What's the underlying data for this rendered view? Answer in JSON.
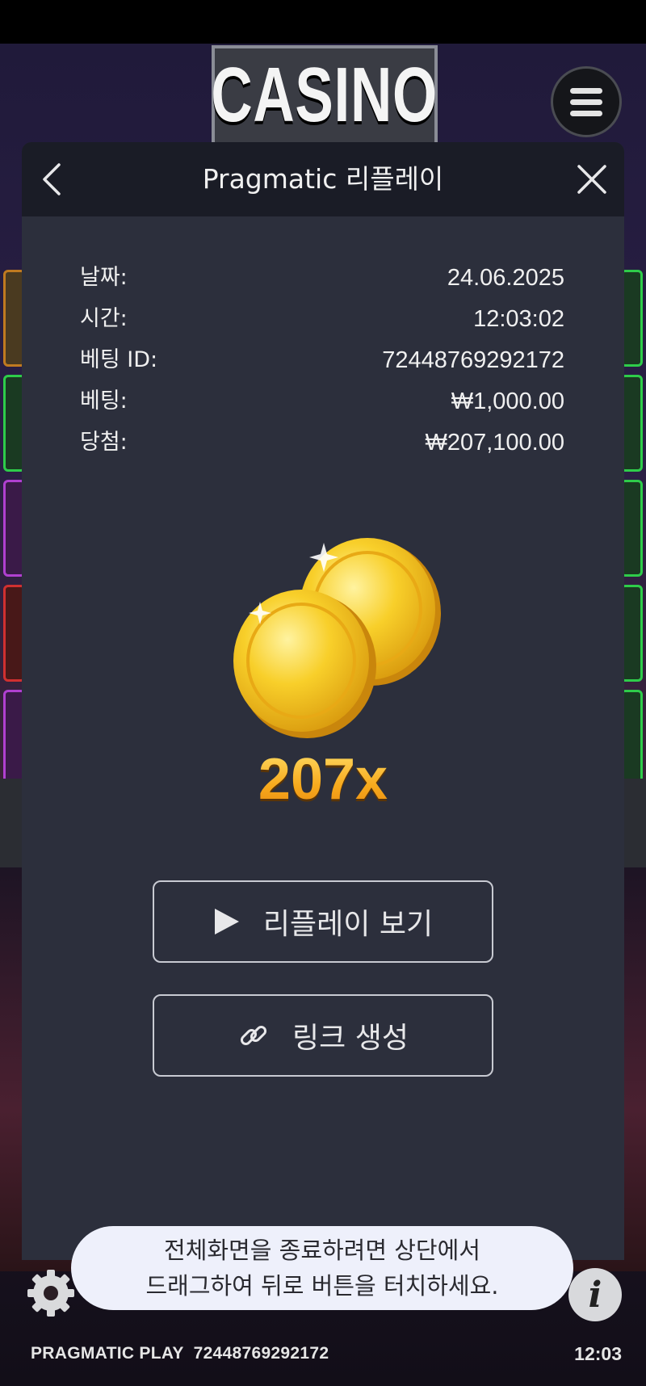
{
  "game": {
    "sign_text": "CASINO"
  },
  "modal": {
    "title": "Pragmatic 리플레이",
    "rows": [
      {
        "label": "날짜:",
        "value": "24.06.2025"
      },
      {
        "label": "시간:",
        "value": "12:03:02"
      },
      {
        "label": "베팅 ID:",
        "value": "72448769292172"
      },
      {
        "label": "베팅:",
        "value": "₩1,000.00"
      },
      {
        "label": "당첨:",
        "value": "₩207,100.00"
      }
    ],
    "multiplier": "207x",
    "replay_label": "리플레이 보기",
    "link_label": "링크 생성"
  },
  "toast": {
    "line1": "전체화면을 종료하려면 상단에서",
    "line2": "드래그하여 뒤로 버튼을 터치하세요."
  },
  "footer": {
    "brand": "PRAGMATIC PLAY  72448769292172",
    "time": "12:03"
  },
  "colors": {
    "modal_bg": "#2c2f3c",
    "header_bg": "#1a1c26",
    "gold": "#f5b11e",
    "toast_bg": "#eef0fb"
  },
  "icons": [
    "back-arrow-icon",
    "close-icon",
    "menu-icon",
    "play-icon",
    "link-icon",
    "gear-icon",
    "info-icon",
    "coins-icon"
  ]
}
